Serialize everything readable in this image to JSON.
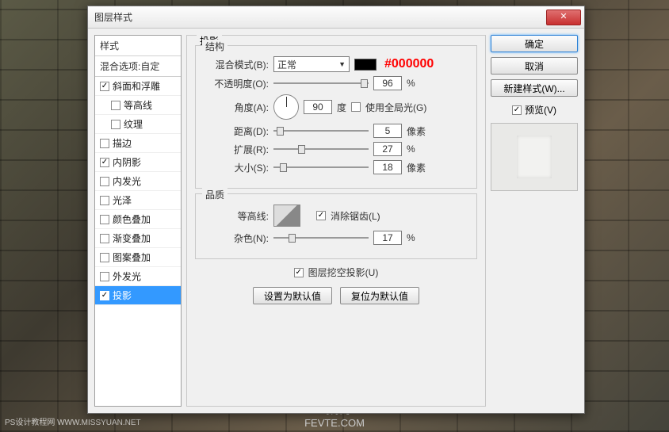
{
  "window": {
    "title": "图层样式"
  },
  "sidebar": {
    "header_styles": "样式",
    "header_blend": "混合选项:自定",
    "items": [
      {
        "label": "斜面和浮雕",
        "checked": true,
        "indent": false
      },
      {
        "label": "等高线",
        "checked": false,
        "indent": true
      },
      {
        "label": "纹理",
        "checked": false,
        "indent": true
      },
      {
        "label": "描边",
        "checked": false,
        "indent": false
      },
      {
        "label": "内阴影",
        "checked": true,
        "indent": false
      },
      {
        "label": "内发光",
        "checked": false,
        "indent": false
      },
      {
        "label": "光泽",
        "checked": false,
        "indent": false
      },
      {
        "label": "颜色叠加",
        "checked": false,
        "indent": false
      },
      {
        "label": "渐变叠加",
        "checked": false,
        "indent": false
      },
      {
        "label": "图案叠加",
        "checked": false,
        "indent": false
      },
      {
        "label": "外发光",
        "checked": false,
        "indent": false
      },
      {
        "label": "投影",
        "checked": true,
        "indent": false,
        "selected": true
      }
    ]
  },
  "panel": {
    "title": "投影",
    "structure": {
      "legend": "结构",
      "blend_mode_label": "混合模式(B):",
      "blend_mode_value": "正常",
      "color_hex": "#000000",
      "opacity_label": "不透明度(O):",
      "opacity_value": "96",
      "opacity_unit": "%",
      "angle_label": "角度(A):",
      "angle_value": "90",
      "angle_unit": "度",
      "use_global_light_label": "使用全局光(G)",
      "use_global_light_checked": false,
      "distance_label": "距离(D):",
      "distance_value": "5",
      "distance_unit": "像素",
      "spread_label": "扩展(R):",
      "spread_value": "27",
      "spread_unit": "%",
      "size_label": "大小(S):",
      "size_value": "18",
      "size_unit": "像素"
    },
    "quality": {
      "legend": "品质",
      "contour_label": "等高线:",
      "antialias_label": "消除锯齿(L)",
      "antialias_checked": true,
      "noise_label": "杂色(N):",
      "noise_value": "17",
      "noise_unit": "%"
    },
    "knockout_label": "图层挖空投影(U)",
    "knockout_checked": true,
    "set_default": "设置为默认值",
    "reset_default": "复位为默认值"
  },
  "right": {
    "ok": "确定",
    "cancel": "取消",
    "new_style": "新建样式(W)...",
    "preview_label": "预览(V)",
    "preview_checked": true
  },
  "footer": {
    "site1": "飞特网",
    "site2": "FEVTE.COM"
  },
  "watermark": "PS设计教程网  WWW.MISSYUAN.NET"
}
